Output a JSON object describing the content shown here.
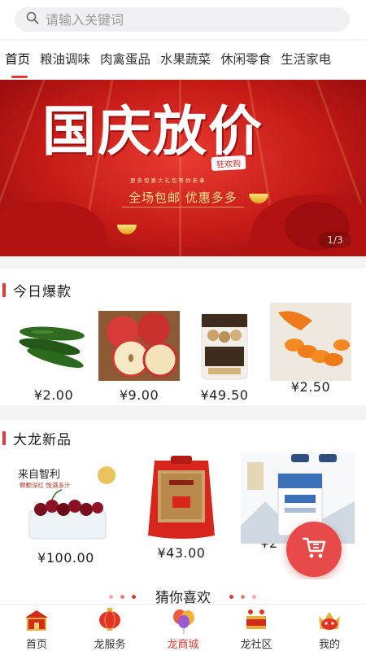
{
  "search": {
    "placeholder": "请输入关键词"
  },
  "tabs": [
    {
      "label": "首页"
    },
    {
      "label": "粮油调味"
    },
    {
      "label": "肉禽蛋品"
    },
    {
      "label": "水果蔬菜"
    },
    {
      "label": "休闲零食"
    },
    {
      "label": "生活家电"
    }
  ],
  "banner": {
    "title": "国庆放价",
    "stamp": "狂欢购",
    "subtitle_small": "更多惊喜大礼包等你来拿",
    "subtitle": "全场包邮 优惠多多",
    "indicator": "1/3"
  },
  "hot": {
    "title": "今日爆款",
    "items": [
      {
        "name": "cucumber",
        "price": "¥2.00"
      },
      {
        "name": "apple",
        "price": "¥9.00"
      },
      {
        "name": "coconut-snacks",
        "price": "¥49.50"
      },
      {
        "name": "carrot",
        "price": "¥2.50"
      }
    ]
  },
  "new": {
    "title": "大龙新品",
    "items": [
      {
        "name": "cherries",
        "label": "来自智利",
        "label_sub": "颗颗深红 饱满多汁",
        "price": "¥100.00"
      },
      {
        "name": "rice-bag",
        "price": "¥43.00"
      },
      {
        "name": "flour-bag",
        "price": "¥2"
      }
    ]
  },
  "guess": {
    "title": "猜你喜欢"
  },
  "colors": {
    "accent": "#e53935",
    "banner": "#c41a17",
    "fab": "#e84a4a"
  },
  "bottom_nav": [
    {
      "label": "首页",
      "icon": "home-icon"
    },
    {
      "label": "龙服务",
      "icon": "lantern-icon"
    },
    {
      "label": "龙商城",
      "icon": "balloons-icon"
    },
    {
      "label": "龙社区",
      "icon": "drum-icon"
    },
    {
      "label": "我的",
      "icon": "crown-icon"
    }
  ]
}
